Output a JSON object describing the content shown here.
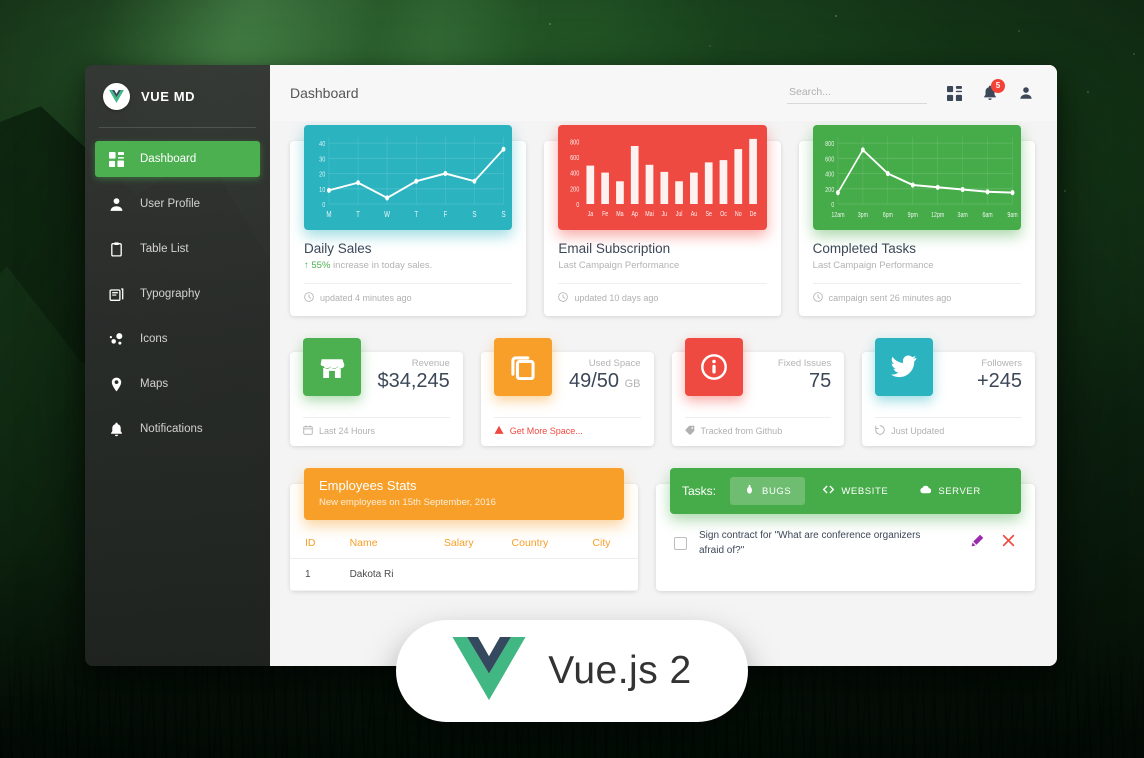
{
  "sidebar": {
    "brand": "VUE MD",
    "brand_logo_icon": "vue-logo-icon",
    "items": [
      {
        "label": "Dashboard",
        "icon": "dashboard-grid-icon",
        "active": true
      },
      {
        "label": "User Profile",
        "icon": "person-icon",
        "active": false
      },
      {
        "label": "Table List",
        "icon": "clipboard-icon",
        "active": false
      },
      {
        "label": "Typography",
        "icon": "typography-icon",
        "active": false
      },
      {
        "label": "Icons",
        "icon": "bubbles-icon",
        "active": false
      },
      {
        "label": "Maps",
        "icon": "map-pin-icon",
        "active": false
      },
      {
        "label": "Notifications",
        "icon": "bell-icon",
        "active": false
      }
    ]
  },
  "header": {
    "title": "Dashboard",
    "search_placeholder": "Search...",
    "search_value": "",
    "dashboard_icon": "dashboard-grid-icon",
    "bell_icon": "bell-icon",
    "notification_count": "5",
    "person_icon": "person-icon"
  },
  "chart_cards": [
    {
      "title": "Daily Sales",
      "subtitle_accent": "55%",
      "subtitle": "increase in today sales.",
      "footer": "updated 4 minutes ago",
      "footer_icon": "clock-icon",
      "color": "#2bb3c0"
    },
    {
      "title": "Email Subscription",
      "subtitle": "Last Campaign Performance",
      "footer": "updated 10 days ago",
      "footer_icon": "clock-icon",
      "color": "#ef4a41"
    },
    {
      "title": "Completed Tasks",
      "subtitle": "Last Campaign Performance",
      "footer": "campaign sent 26 minutes ago",
      "footer_icon": "clock-icon",
      "color": "#46ab49"
    }
  ],
  "chart_data": [
    {
      "type": "line",
      "title": "Daily Sales",
      "categories": [
        "M",
        "T",
        "W",
        "T",
        "F",
        "S",
        "S"
      ],
      "values": [
        9,
        14,
        4,
        15,
        20,
        15,
        36
      ],
      "yticks": [
        0,
        10,
        20,
        30,
        40
      ],
      "ylim": [
        0,
        44
      ],
      "xlabel": "",
      "ylabel": "",
      "grid": true,
      "color": "#ffffff",
      "background": "#2bb3c0"
    },
    {
      "type": "bar",
      "title": "Email Subscription",
      "categories": [
        "Ja",
        "Fe",
        "Ma",
        "Ap",
        "Mai",
        "Ju",
        "Jul",
        "Au",
        "Se",
        "Oc",
        "No",
        "De"
      ],
      "values": [
        490,
        400,
        290,
        740,
        500,
        410,
        290,
        400,
        530,
        560,
        700,
        830
      ],
      "yticks": [
        0,
        200,
        400,
        600,
        800
      ],
      "ylim": [
        0,
        880
      ],
      "xlabel": "",
      "ylabel": "",
      "grid": false,
      "color": "#ffffff",
      "background": "#ef4a41"
    },
    {
      "type": "line",
      "title": "Completed Tasks",
      "categories": [
        "12am",
        "3pm",
        "6pm",
        "9pm",
        "12pm",
        "3am",
        "6am",
        "9am"
      ],
      "values": [
        150,
        710,
        400,
        250,
        220,
        190,
        160,
        150
      ],
      "yticks": [
        0,
        200,
        400,
        600,
        800
      ],
      "ylim": [
        0,
        880
      ],
      "xlabel": "",
      "ylabel": "",
      "grid": true,
      "color": "#ffffff",
      "background": "#46ab49"
    }
  ],
  "stat_cards": [
    {
      "icon": "store-icon",
      "icon_color": "#4caf50",
      "label": "Revenue",
      "value": "$34,245",
      "unit": "",
      "footer": "Last 24 Hours",
      "footer_icon": "calendar-icon",
      "footer_warn": false
    },
    {
      "icon": "copy-icon",
      "icon_color": "#f79f28",
      "label": "Used Space",
      "value": "49/50",
      "unit": "GB",
      "footer": "Get More Space...",
      "footer_icon": "warning-icon",
      "footer_warn": true
    },
    {
      "icon": "info-icon",
      "icon_color": "#ef4a41",
      "label": "Fixed Issues",
      "value": "75",
      "unit": "",
      "footer": "Tracked from Github",
      "footer_icon": "tag-icon",
      "footer_warn": false
    },
    {
      "icon": "twitter-icon",
      "icon_color": "#2bb3c0",
      "label": "Followers",
      "value": "+245",
      "unit": "",
      "footer": "Just Updated",
      "footer_icon": "update-icon",
      "footer_warn": false
    }
  ],
  "employees": {
    "title": "Employees Stats",
    "subtitle": "New employees on 15th September, 2016",
    "columns": [
      "ID",
      "Name",
      "Salary",
      "Country",
      "City"
    ],
    "rows": [
      {
        "id": "1",
        "name": "Dakota Ri",
        "salary": "",
        "country": "",
        "city": ""
      }
    ]
  },
  "tasks": {
    "label": "Tasks:",
    "tabs": [
      {
        "label": "BUGS",
        "icon": "bug-icon",
        "active": true
      },
      {
        "label": "WEBSITE",
        "icon": "code-icon",
        "active": false
      },
      {
        "label": "SERVER",
        "icon": "cloud-icon",
        "active": false
      }
    ],
    "items": [
      {
        "text": "Sign contract for \"What are conference organizers afraid of?\"",
        "checked": false,
        "edit_icon": "pencil-icon",
        "delete_icon": "close-icon"
      }
    ]
  },
  "vue_badge": {
    "text": "Vue.js 2",
    "logo_icon": "vue-logo-icon",
    "logo_green": "#41b883",
    "logo_navy": "#35495e"
  }
}
